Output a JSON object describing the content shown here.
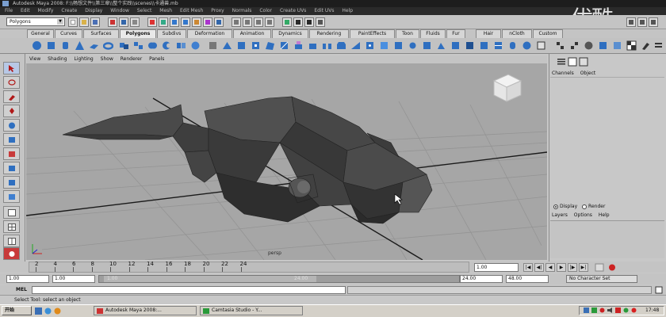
{
  "window": {
    "title": "Autodesk Maya 2008: F:\\\\畅想文件\\\\第三章\\\\整个实践\\\\scenes\\\\卡通兽.mb",
    "menus": [
      "File",
      "Edit",
      "Modify",
      "Create",
      "Display",
      "Window",
      "Select",
      "Mesh",
      "Edit Mesh",
      "Proxy",
      "Normals",
      "Color",
      "Create UVs",
      "Edit UVs",
      "Help"
    ]
  },
  "status_line": {
    "mode_selector": "Polygons"
  },
  "shelf": {
    "tabs": [
      "General",
      "Curves",
      "Surfaces",
      "Polygons",
      "Subdivs",
      "Deformation",
      "Animation",
      "Dynamics",
      "Rendering",
      "PaintEffects",
      "Toon",
      "Fluids",
      "Fur",
      "Hair",
      "nCloth",
      "Custom"
    ],
    "active_tab": "Polygons"
  },
  "panel": {
    "menus": [
      "View",
      "Shading",
      "Lighting",
      "Show",
      "Renderer",
      "Panels"
    ],
    "camera": "persp"
  },
  "channel_box": {
    "header_menus": [
      "Channels",
      "Object"
    ],
    "layer_mode_display": "Display",
    "layer_mode_render": "Render",
    "layer_menus": [
      "Layers",
      "Options",
      "Help"
    ]
  },
  "timeline": {
    "ticks": [
      "2",
      "4",
      "6",
      "8",
      "10",
      "12",
      "14",
      "16",
      "18",
      "20",
      "22",
      "24"
    ],
    "current_time": "1.00",
    "playback_buttons": [
      "|◀",
      "◀|",
      "◀",
      "▶",
      "|▶",
      "▶|"
    ]
  },
  "range_slider": {
    "start_time": "1.00",
    "playback_start": "1.00",
    "range_start_label": "1.00",
    "range_end_label": "24.00",
    "playback_end": "24.00",
    "end_time": "48.00",
    "character_set": "No Character Set"
  },
  "command_line": {
    "label": "MEL"
  },
  "help_line": {
    "text": "Select Tool: select an object"
  },
  "taskbar": {
    "start_label": "开始",
    "tasks": [
      "Autodesk Maya 2008:...",
      "Camtasia Studio - Y..."
    ],
    "clock": "17:48"
  },
  "watermark": "优酷",
  "colors": {
    "viewport_bg": "#a6a6a6",
    "grid_line": "#8f8f8f",
    "model_dark": "#3a3a3a",
    "ui_panel": "#c4c4c4",
    "title_bar": "#1d1d1d"
  }
}
